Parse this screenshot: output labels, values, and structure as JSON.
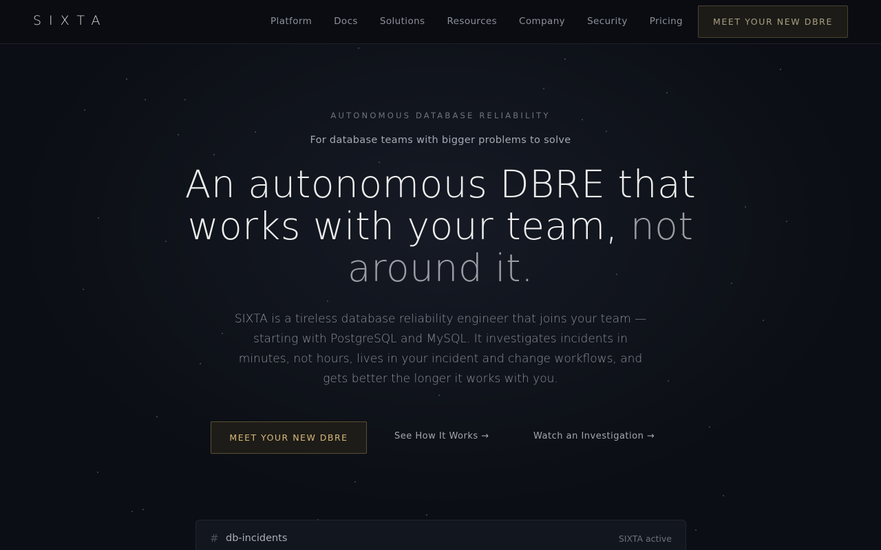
{
  "nav": {
    "logo": "SIXTA",
    "links": [
      "Platform",
      "Docs",
      "Solutions",
      "Resources",
      "Company",
      "Security",
      "Pricing"
    ],
    "cta": "MEET YOUR NEW DBRE"
  },
  "hero": {
    "eyebrow": "AUTONOMOUS DATABASE RELIABILITY",
    "sub_eyebrow": "For database teams with bigger problems to solve",
    "headline_main": "An autonomous DBRE that works with your team,",
    "headline_muted": "not around it.",
    "description": "SIXTA is a tireless database reliability engineer that joins your team — starting with PostgreSQL and MySQL. It investigates incidents in minutes, not hours, lives in your incident and change workflows, and gets better the longer it works with you.",
    "primary_cta": "MEET YOUR NEW DBRE",
    "link_how": "See How It Works →",
    "link_watch": "Watch an Investigation →"
  },
  "panel": {
    "hash": "#",
    "channel": "db-incidents",
    "status": "SIXTA active"
  },
  "colors": {
    "background": "#0b0e14",
    "accent_gold": "#d6b97a",
    "button_border": "#5b4f33"
  }
}
